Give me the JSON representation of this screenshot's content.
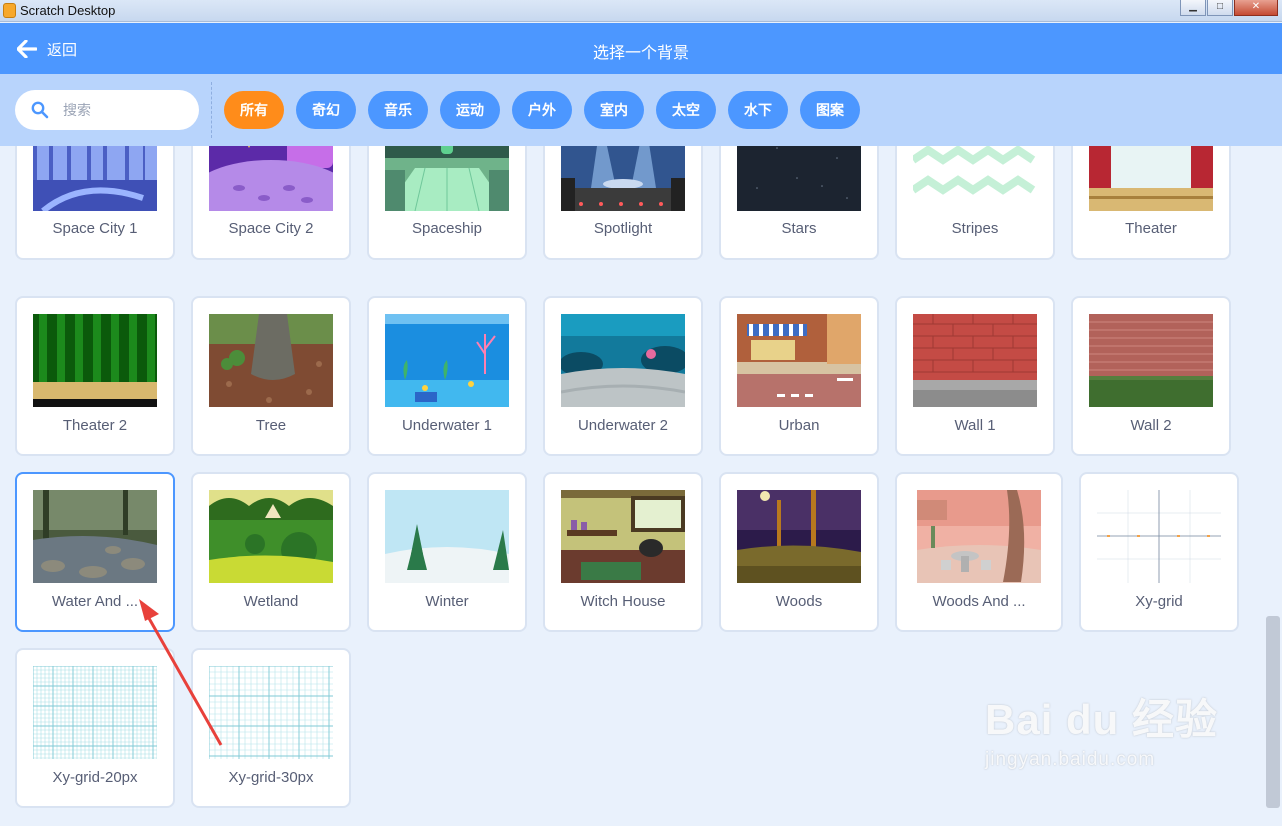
{
  "window": {
    "title": "Scratch Desktop",
    "min": "▁",
    "max": "□",
    "close": "✕"
  },
  "header": {
    "back_label": "返回",
    "title": "选择一个背景"
  },
  "search": {
    "placeholder": "搜索"
  },
  "tags": [
    {
      "label": "所有",
      "active": true
    },
    {
      "label": "奇幻",
      "active": false
    },
    {
      "label": "音乐",
      "active": false
    },
    {
      "label": "运动",
      "active": false
    },
    {
      "label": "户外",
      "active": false
    },
    {
      "label": "室内",
      "active": false
    },
    {
      "label": "太空",
      "active": false
    },
    {
      "label": "水下",
      "active": false
    },
    {
      "label": "图案",
      "active": false
    }
  ],
  "backdrops": [
    {
      "name": "Space City 1",
      "thumb": "space-city-1"
    },
    {
      "name": "Space City 2",
      "thumb": "space-city-2"
    },
    {
      "name": "Spaceship",
      "thumb": "spaceship"
    },
    {
      "name": "Spotlight",
      "thumb": "spotlight"
    },
    {
      "name": "Stars",
      "thumb": "stars"
    },
    {
      "name": "Stripes",
      "thumb": "stripes"
    },
    {
      "name": "Theater",
      "thumb": "theater"
    },
    {
      "name": "Theater 2",
      "thumb": "theater-2"
    },
    {
      "name": "Tree",
      "thumb": "tree"
    },
    {
      "name": "Underwater 1",
      "thumb": "underwater-1"
    },
    {
      "name": "Underwater 2",
      "thumb": "underwater-2"
    },
    {
      "name": "Urban",
      "thumb": "urban"
    },
    {
      "name": "Wall 1",
      "thumb": "wall-1"
    },
    {
      "name": "Wall 2",
      "thumb": "wall-2"
    },
    {
      "name": "Water And ...",
      "thumb": "water-and-rocks",
      "selected": true
    },
    {
      "name": "Wetland",
      "thumb": "wetland"
    },
    {
      "name": "Winter",
      "thumb": "winter"
    },
    {
      "name": "Witch House",
      "thumb": "witch-house"
    },
    {
      "name": "Woods",
      "thumb": "woods"
    },
    {
      "name": "Woods And ...",
      "thumb": "woods-and-bench"
    },
    {
      "name": "Xy-grid",
      "thumb": "xy-grid"
    },
    {
      "name": "Xy-grid-20px",
      "thumb": "xy-grid-20px"
    },
    {
      "name": "Xy-grid-30px",
      "thumb": "xy-grid-30px"
    }
  ],
  "watermark": {
    "brand": "Bai du 经验",
    "url": "jingyan.baidu.com"
  },
  "colors": {
    "header": "#4c97ff",
    "filter_bar": "#b8d4fc",
    "active_tag": "#ff8c1a",
    "background": "#e9f1fc",
    "arrow": "#e8413b"
  }
}
